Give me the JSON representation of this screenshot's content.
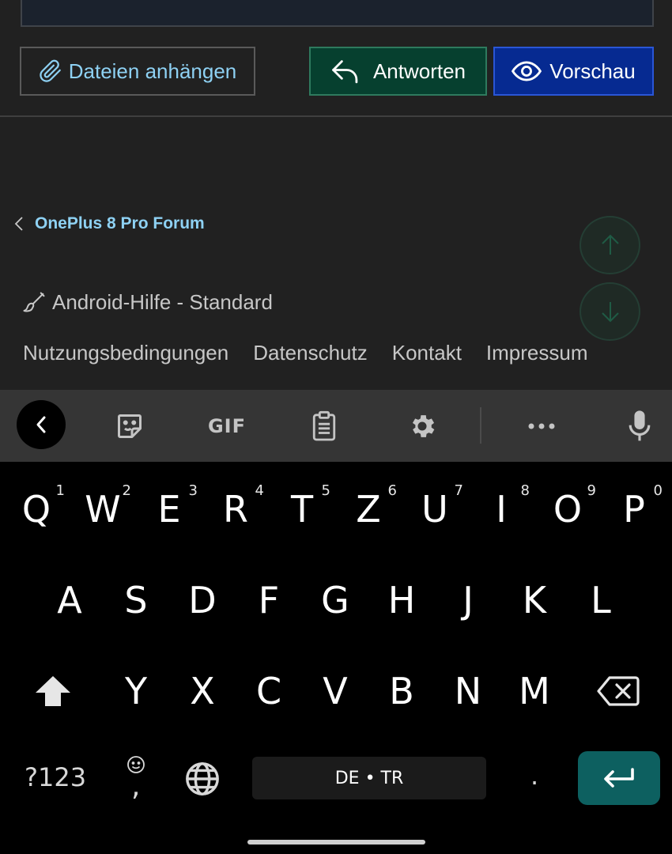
{
  "web": {
    "attach_label": "Dateien anhängen",
    "reply_label": "Antworten",
    "preview_label": "Vorschau",
    "breadcrumb": "OnePlus 8 Pro Forum",
    "style_label": "Android-Hilfe - Standard",
    "footer_links": [
      "Nutzungsbedingungen",
      "Datenschutz",
      "Kontakt",
      "Impressum"
    ],
    "colors": {
      "link": "#8ed1f3",
      "reply_bg": "#06402f",
      "preview_bg": "#062a91"
    }
  },
  "keyboard": {
    "toolbar": {
      "back_icon": "chevron-left-icon",
      "sticker_icon": "sticker-icon",
      "gif_label": "GIF",
      "clipboard_icon": "clipboard-icon",
      "settings_icon": "gear-icon",
      "more_icon": "more-horizontal-icon",
      "mic_icon": "microphone-icon"
    },
    "row1": [
      {
        "key": "Q",
        "hint": "1"
      },
      {
        "key": "W",
        "hint": "2"
      },
      {
        "key": "E",
        "hint": "3"
      },
      {
        "key": "R",
        "hint": "4"
      },
      {
        "key": "T",
        "hint": "5"
      },
      {
        "key": "Z",
        "hint": "6"
      },
      {
        "key": "U",
        "hint": "7"
      },
      {
        "key": "I",
        "hint": "8"
      },
      {
        "key": "O",
        "hint": "9"
      },
      {
        "key": "P",
        "hint": "0"
      }
    ],
    "row2": [
      "A",
      "S",
      "D",
      "F",
      "G",
      "H",
      "J",
      "K",
      "L"
    ],
    "row3": [
      "Y",
      "X",
      "C",
      "V",
      "B",
      "N",
      "M"
    ],
    "symbols_label": "?123",
    "comma_label": ",",
    "space_label": "DE • TR",
    "period_label": ".",
    "enter_color": "#0d6060"
  }
}
